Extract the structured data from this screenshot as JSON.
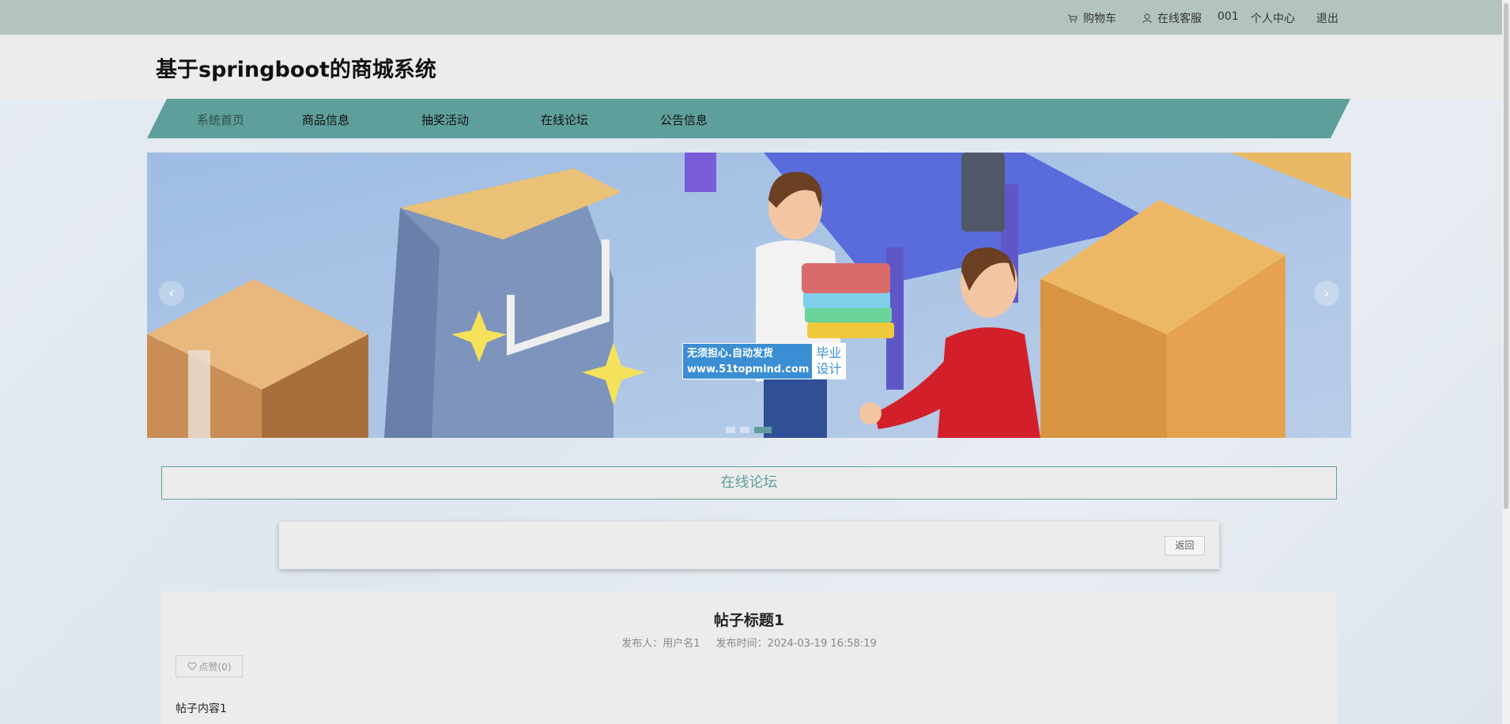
{
  "topbar": {
    "cart_label": "购物车",
    "service_label": "在线客服",
    "username": "001",
    "profile_label": "个人中心",
    "logout_label": "退出"
  },
  "header": {
    "site_title": "基于springboot的商城系统"
  },
  "nav": {
    "items": [
      {
        "label": "系统首页"
      },
      {
        "label": "商品信息"
      },
      {
        "label": "抽奖活动"
      },
      {
        "label": "在线论坛"
      },
      {
        "label": "公告信息"
      }
    ],
    "active_index": 0
  },
  "banner": {
    "prev_arrow": "‹",
    "next_arrow": "›",
    "slide_count": 3,
    "active_slide": 2,
    "watermark_line1": "无须担心.自动发货",
    "watermark_line2": "www.51topmind.com",
    "watermark_badge_line1": "毕业",
    "watermark_badge_line2": "设计"
  },
  "section": {
    "title": "在线论坛"
  },
  "actions": {
    "back_label": "返回"
  },
  "post": {
    "title": "帖子标题1",
    "author_label": "发布人：用户名1",
    "time_label": "发布时间：2024-03-19 16:58:19",
    "like_label": "点赞(0)",
    "content": "帖子内容1"
  },
  "colors": {
    "accent": "#5e9f9b",
    "topbar": "#b3c4bd",
    "header": "#ececec"
  }
}
